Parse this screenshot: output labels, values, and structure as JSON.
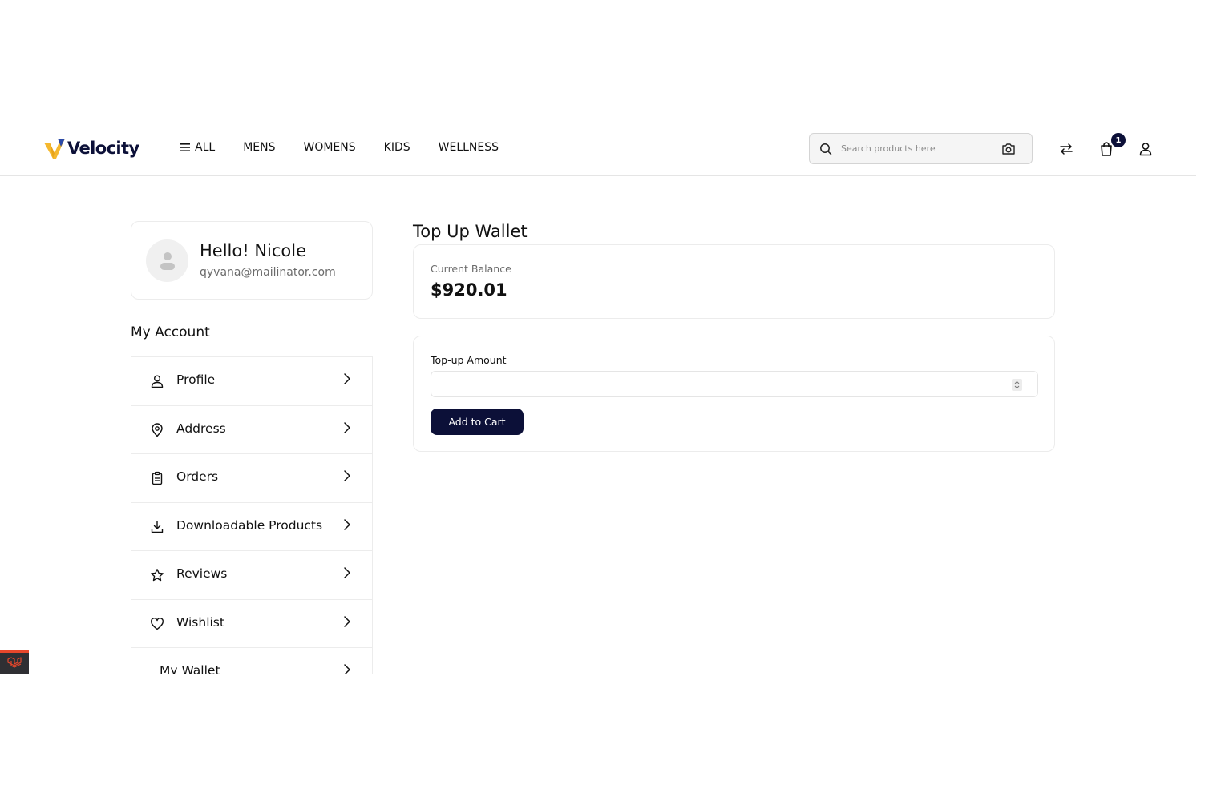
{
  "header": {
    "brand": "Velocity",
    "nav": [
      {
        "label": "ALL"
      },
      {
        "label": "MENS"
      },
      {
        "label": "WOMENS"
      },
      {
        "label": "KIDS"
      },
      {
        "label": "WELLNESS"
      }
    ],
    "search_placeholder": "Search products here",
    "cart_count": "1",
    "icons": {
      "menu": "hamburger-icon",
      "search": "search-icon",
      "camera": "camera-icon",
      "compare": "compare-arrows-icon",
      "cart": "shopping-bag-icon",
      "account": "user-icon"
    }
  },
  "profile": {
    "greeting": "Hello! Nicole",
    "email": "qyvana@mailinator.com"
  },
  "sidebar": {
    "title": "My Account",
    "items": [
      {
        "label": "Profile",
        "icon": "user-icon"
      },
      {
        "label": "Address",
        "icon": "location-pin-icon"
      },
      {
        "label": "Orders",
        "icon": "clipboard-icon"
      },
      {
        "label": "Downloadable Products",
        "icon": "download-icon"
      },
      {
        "label": "Reviews",
        "icon": "star-icon"
      },
      {
        "label": "Wishlist",
        "icon": "heart-icon"
      },
      {
        "label": "My Wallet",
        "icon": ""
      }
    ]
  },
  "main": {
    "title": "Top Up Wallet",
    "balance_label": "Current Balance",
    "balance_value": "$920.01",
    "topup_label": "Top-up Amount",
    "topup_value": "",
    "add_button": "Add to Cart"
  },
  "colors": {
    "brand_navy": "#0c1038",
    "logo_yellow": "#f5b82e",
    "debug_red": "#e8472b"
  }
}
